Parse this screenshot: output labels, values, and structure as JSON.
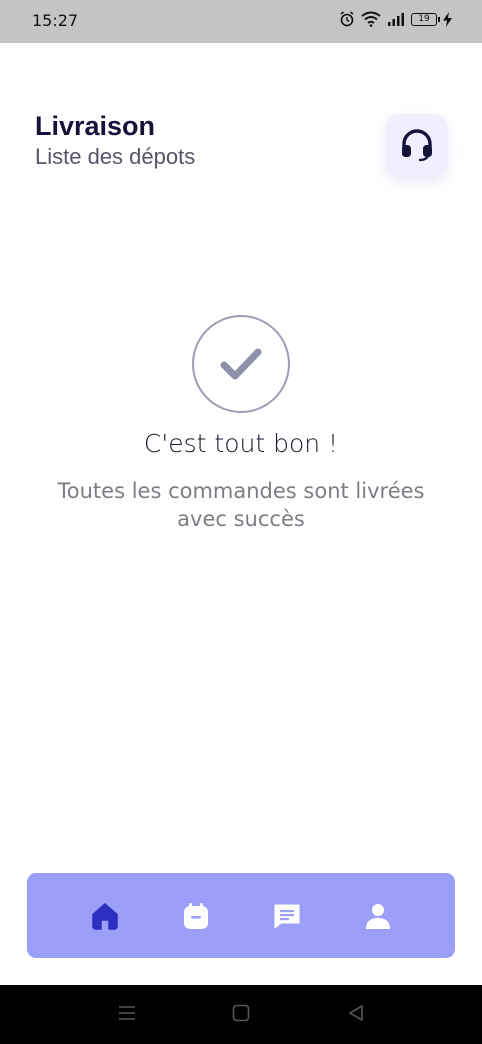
{
  "status_bar": {
    "time": "15:27",
    "battery_level": "19"
  },
  "header": {
    "title": "Livraison",
    "subtitle": "Liste des dépots"
  },
  "support_button": {
    "icon": "headset-icon"
  },
  "empty_state": {
    "icon": "check-icon",
    "title": "C'est tout bon !",
    "message": "Toutes les commandes sont livrées avec succès"
  },
  "bottom_nav": {
    "items": [
      {
        "icon": "home-icon",
        "active": true
      },
      {
        "icon": "calendar-icon",
        "active": false
      },
      {
        "icon": "chat-icon",
        "active": false
      },
      {
        "icon": "user-icon",
        "active": false
      }
    ]
  },
  "colors": {
    "nav_background": "#9b9ff7",
    "nav_active": "#2c2fbf",
    "nav_inactive": "#ffffff",
    "title": "#15133a",
    "support_bg": "#f1efff"
  }
}
